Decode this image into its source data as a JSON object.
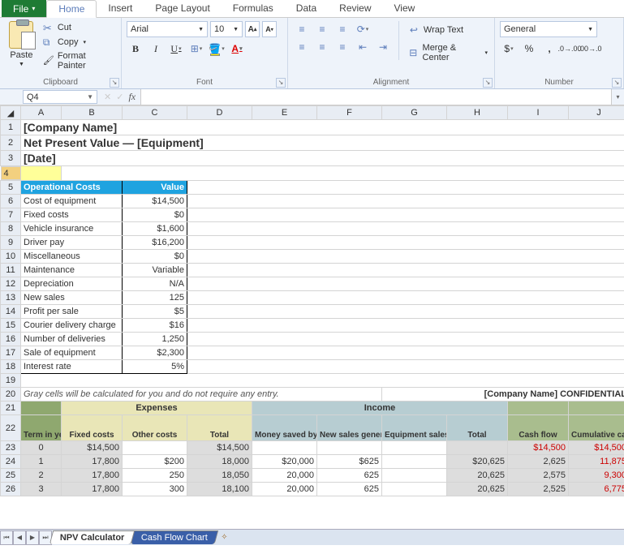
{
  "tabs": {
    "file": "File",
    "home": "Home",
    "insert": "Insert",
    "pageLayout": "Page Layout",
    "formulas": "Formulas",
    "data": "Data",
    "review": "Review",
    "view": "View"
  },
  "clipboard": {
    "title": "Clipboard",
    "paste": "Paste",
    "cut": "Cut",
    "copy": "Copy",
    "formatPainter": "Format Painter"
  },
  "font": {
    "title": "Font",
    "name": "Arial",
    "size": "10"
  },
  "alignment": {
    "title": "Alignment",
    "wrap": "Wrap Text",
    "merge": "Merge & Center"
  },
  "number": {
    "title": "Number",
    "format": "General"
  },
  "nameBox": "Q4",
  "formula": "",
  "cols": [
    "A",
    "B",
    "C",
    "D",
    "E",
    "F",
    "G",
    "H",
    "I",
    "J"
  ],
  "header": {
    "company": "[Company Name]",
    "title": "Net Present Value — [Equipment]",
    "date": "[Date]"
  },
  "op": {
    "h1": "Operational Costs",
    "h2": "Value",
    "rows": [
      {
        "l": "Cost of equipment",
        "v": "$14,500"
      },
      {
        "l": "Fixed costs",
        "v": "$0"
      },
      {
        "l": "Vehicle insurance",
        "v": "$1,600"
      },
      {
        "l": "Driver pay",
        "v": "$16,200"
      },
      {
        "l": "Miscellaneous",
        "v": "$0"
      },
      {
        "l": "Maintenance",
        "v": "Variable"
      },
      {
        "l": "Depreciation",
        "v": "N/A"
      },
      {
        "l": "New sales",
        "v": "125"
      },
      {
        "l": "Profit per sale",
        "v": "$5"
      },
      {
        "l": "Courier delivery charge",
        "v": "$16"
      },
      {
        "l": "Number of deliveries",
        "v": "1,250"
      },
      {
        "l": "Sale of equipment",
        "v": "$2,300"
      },
      {
        "l": "Interest rate",
        "v": "5%"
      }
    ]
  },
  "note": "Gray cells will be calculated for you and do not require any entry.",
  "confidential": "[Company Name] CONFIDENTIAL",
  "table": {
    "expenses": "Expenses",
    "income": "Income",
    "cols": {
      "term": "Term in years",
      "fixed": "Fixed costs",
      "other": "Other costs",
      "total": "Total",
      "saved": "Money saved by project",
      "newsales": "New sales generated by project",
      "equip": "Equipment sales",
      "itotal": "Total",
      "cashflow": "Cash flow",
      "cumcf": "Cumulative cash flow"
    },
    "rows": [
      {
        "term": "0",
        "fixed": "$14,500",
        "other": "",
        "total": "$14,500",
        "saved": "",
        "newsales": "",
        "equip": "",
        "itotal": "",
        "cf": "$14,500",
        "ccf": "$14,500",
        "neg": true
      },
      {
        "term": "1",
        "fixed": "17,800",
        "other": "$200",
        "total": "18,000",
        "saved": "$20,000",
        "newsales": "$625",
        "equip": "",
        "itotal": "$20,625",
        "cf": "2,625",
        "ccf": "11,875",
        "neg": true
      },
      {
        "term": "2",
        "fixed": "17,800",
        "other": "250",
        "total": "18,050",
        "saved": "20,000",
        "newsales": "625",
        "equip": "",
        "itotal": "20,625",
        "cf": "2,575",
        "ccf": "9,300",
        "neg": true
      },
      {
        "term": "3",
        "fixed": "17,800",
        "other": "300",
        "total": "18,100",
        "saved": "20,000",
        "newsales": "625",
        "equip": "",
        "itotal": "20,625",
        "cf": "2,525",
        "ccf": "6,775",
        "neg": true
      }
    ]
  },
  "sheetTabs": {
    "t1": "NPV Calculator",
    "t2": "Cash Flow Chart"
  }
}
